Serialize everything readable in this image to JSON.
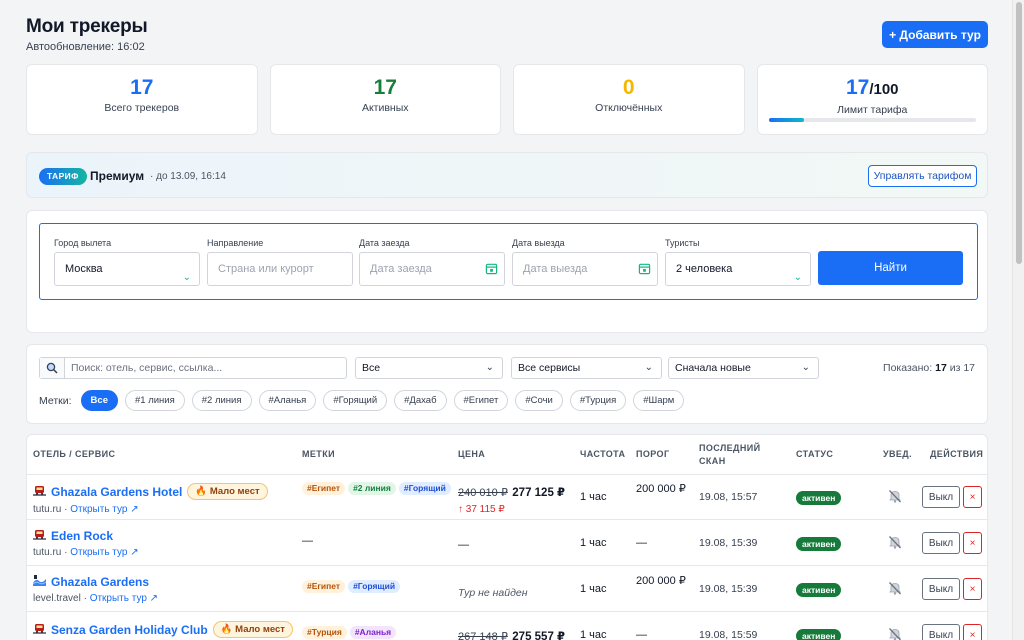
{
  "header": {
    "title": "Мои трекеры",
    "autoupdate": "Автообновление: 16:02",
    "add_button": "+ Добавить тур"
  },
  "stats": [
    {
      "value": "17",
      "label": "Всего трекеров",
      "color": "#1a6ef5"
    },
    {
      "value": "17",
      "label": "Активных",
      "color": "#16803a"
    },
    {
      "value": "0",
      "label": "Отключённых",
      "color": "#f5b800"
    },
    {
      "value": "17",
      "suffix": "/100",
      "label": "Лимит тарифа",
      "color": "#1a6ef5",
      "progress": 0.17
    }
  ],
  "plan": {
    "badge": "ТАРИФ",
    "name": "Премиум",
    "until": "· до 13.09, 16:14",
    "manage_button": "Управлять тарифом"
  },
  "search": {
    "fields": [
      {
        "label": "Город вылета",
        "value": "Москва",
        "placeholder": "",
        "kind": "select"
      },
      {
        "label": "Направление",
        "value": "",
        "placeholder": "Страна или курорт",
        "kind": "text"
      },
      {
        "label": "Дата заезда",
        "value": "",
        "placeholder": "Дата заезда",
        "kind": "date"
      },
      {
        "label": "Дата выезда",
        "value": "",
        "placeholder": "Дата выезда",
        "kind": "date"
      },
      {
        "label": "Туристы",
        "value": "2 человека",
        "placeholder": "",
        "kind": "select"
      }
    ],
    "find_button": "Найти"
  },
  "filters": {
    "search_placeholder": "Поиск: отель, сервис, ссылка...",
    "status_select": "Все",
    "service_select": "Все сервисы",
    "sort_select": "Сначала новые",
    "shown_prefix": "Показано:",
    "shown_count": "17",
    "shown_of": "из 17",
    "tags_label": "Метки:",
    "tags": [
      "Все",
      "#1 линия",
      "#2 линия",
      "#Аланья",
      "#Горящий",
      "#Дахаб",
      "#Египет",
      "#Сочи",
      "#Турция",
      "#Шарм"
    ],
    "active_tag": 0
  },
  "table": {
    "columns": [
      "Отель / сервис",
      "Метки",
      "Цена",
      "Частота",
      "Порог",
      "Последний скан",
      "Статус",
      "Увед.",
      "Действия"
    ],
    "rows": [
      {
        "service_icon": "train-icon",
        "hotel": "Ghazala Gardens Hotel",
        "few_badge": "🔥 Мало мест",
        "service": "tutu.ru",
        "open_link": "Открыть тур ↗",
        "tags": [
          {
            "text": "#Египет",
            "cls": "t-egypt"
          },
          {
            "text": "#2 линия",
            "cls": "t-line2"
          },
          {
            "text": "#Горящий",
            "cls": "t-hot"
          }
        ],
        "price_old": "240 010 ₽",
        "price_new": "277 125 ₽",
        "price_delta": "↑ 37 115 ₽",
        "not_found": "",
        "frequency": "1 час",
        "threshold": "200 000 ₽",
        "last_scan": "19.08, 15:57",
        "status": "активен",
        "off_button": "Выкл",
        "delete_button": "×"
      },
      {
        "service_icon": "train-icon",
        "hotel": "Eden Rock",
        "few_badge": "",
        "service": "tutu.ru",
        "open_link": "Открыть тур ↗",
        "tags": [],
        "tags_empty": "—",
        "price_old": "",
        "price_new": "",
        "price_delta": "",
        "price_empty": "—",
        "not_found": "",
        "frequency": "1 час",
        "threshold": "—",
        "last_scan": "19.08, 15:39",
        "status": "активен",
        "off_button": "Выкл",
        "delete_button": "×"
      },
      {
        "service_icon": "wave-icon",
        "hotel": "Ghazala Gardens",
        "few_badge": "",
        "service": "level.travel",
        "open_link": "Открыть тур ↗",
        "tags": [
          {
            "text": "#Египет",
            "cls": "t-egypt"
          },
          {
            "text": "#Горящий",
            "cls": "t-hot"
          }
        ],
        "price_old": "",
        "price_new": "",
        "price_delta": "",
        "not_found": "Тур не найден",
        "frequency": "1 час",
        "threshold": "200 000 ₽",
        "last_scan": "19.08, 15:39",
        "status": "активен",
        "off_button": "Выкл",
        "delete_button": "×"
      },
      {
        "service_icon": "train-icon",
        "hotel": "Senza Garden Holiday Club",
        "few_badge": "🔥 Мало мест",
        "service": "",
        "open_link": "",
        "tags": [
          {
            "text": "#Турция",
            "cls": "t-turkey"
          },
          {
            "text": "#Аланья",
            "cls": "t-alanya"
          }
        ],
        "price_old": "267 148 ₽",
        "price_new": "275 557 ₽",
        "price_delta": "",
        "not_found": "",
        "frequency": "1 час",
        "threshold": "—",
        "last_scan": "19.08, 15:59",
        "status": "активен",
        "off_button": "Выкл",
        "delete_button": "×"
      }
    ]
  }
}
